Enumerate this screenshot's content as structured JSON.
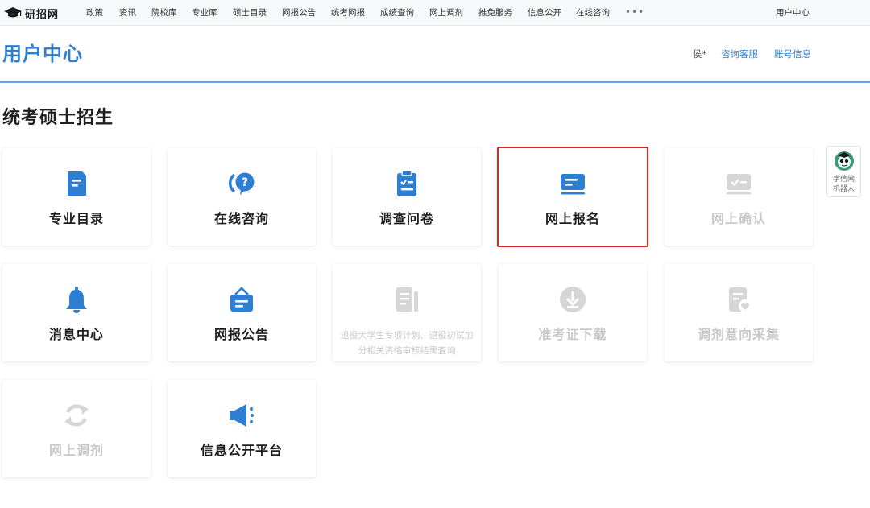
{
  "nav": {
    "logo_text": "研招网",
    "items": [
      "政策",
      "资讯",
      "院校库",
      "专业库",
      "硕士目录",
      "网报公告",
      "统考网报",
      "成绩查询",
      "网上调剂",
      "推免服务",
      "信息公开",
      "在线咨询"
    ],
    "more": "•••",
    "user_center": "用户中心"
  },
  "header": {
    "title": "用户中心",
    "user_name": "侯*",
    "consult_link": "咨询客服",
    "account_link": "账号信息"
  },
  "section": {
    "title": "统考硕士招生"
  },
  "cards": [
    {
      "label": "专业目录",
      "icon": "document-list-icon",
      "enabled": true
    },
    {
      "label": "在线咨询",
      "icon": "question-chat-icon",
      "enabled": true
    },
    {
      "label": "调查问卷",
      "icon": "clipboard-check-icon",
      "enabled": true
    },
    {
      "label": "网上报名",
      "icon": "card-form-icon",
      "enabled": true,
      "highlighted": true
    },
    {
      "label": "网上确认",
      "icon": "check-card-icon",
      "enabled": false
    },
    {
      "label": "消息中心",
      "icon": "bell-icon",
      "enabled": true
    },
    {
      "label": "网报公告",
      "icon": "announcement-bag-icon",
      "enabled": true
    },
    {
      "label": "退役大学生专项计划、退役初试加分相关资格审核结果查询",
      "icon": "document-columns-icon",
      "enabled": false
    },
    {
      "label": "准考证下载",
      "icon": "download-circle-icon",
      "enabled": false
    },
    {
      "label": "调剂意向采集",
      "icon": "document-heart-icon",
      "enabled": false
    },
    {
      "label": "网上调剂",
      "icon": "refresh-arrows-icon",
      "enabled": false
    },
    {
      "label": "信息公开平台",
      "icon": "megaphone-icon",
      "enabled": true
    }
  ],
  "robot": {
    "label_line1": "学信网",
    "label_line2": "机器人"
  },
  "colors": {
    "primary": "#2e7fd3",
    "disabled": "#c9c9c9",
    "highlight": "#e02424"
  }
}
